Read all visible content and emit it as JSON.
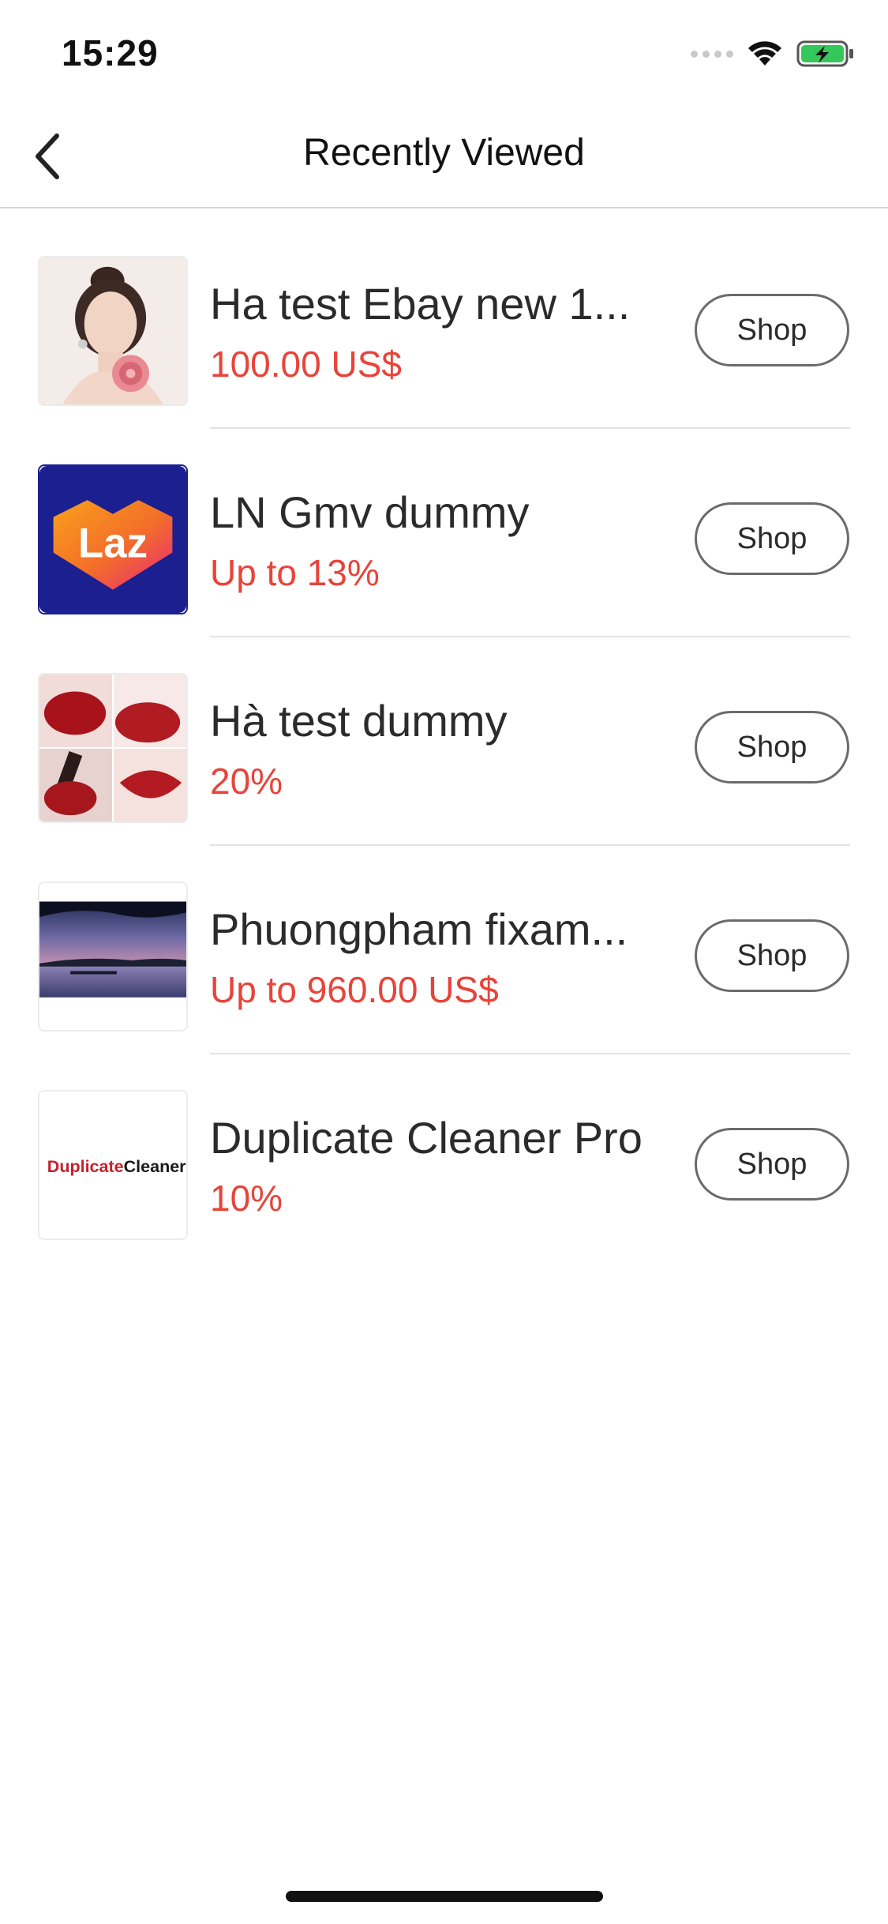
{
  "status_bar": {
    "time": "15:29",
    "icons": [
      "cellular-signal-icon",
      "wifi-icon",
      "battery-charging-icon"
    ]
  },
  "header": {
    "title": "Recently Viewed",
    "back_icon": "chevron-left-icon"
  },
  "items": [
    {
      "name": "Ha test Ebay new 1...",
      "offer": "100.00 US$",
      "button": "Shop",
      "thumb": "portrait-photo"
    },
    {
      "name": "LN Gmv dummy",
      "offer": "Up to 13%",
      "button": "Shop",
      "thumb": "lazada-logo",
      "logo_text": "Laz"
    },
    {
      "name": "Hà test dummy",
      "offer": "20%",
      "button": "Shop",
      "thumb": "lipstick-swatches-photo"
    },
    {
      "name": "Phuongpham fixam...",
      "offer": "Up to 960.00 US$",
      "button": "Shop",
      "thumb": "lake-sunset-photo"
    },
    {
      "name": "Duplicate Cleaner Pro",
      "offer": "10%",
      "button": "Shop",
      "thumb": "duplicate-cleaner-logo",
      "logo_text_a": "Duplicate",
      "logo_text_b": "Cleaner"
    }
  ],
  "colors": {
    "offer": "#e8443a",
    "lazada_bg": "#1b1f8f",
    "battery_green": "#34c759"
  }
}
